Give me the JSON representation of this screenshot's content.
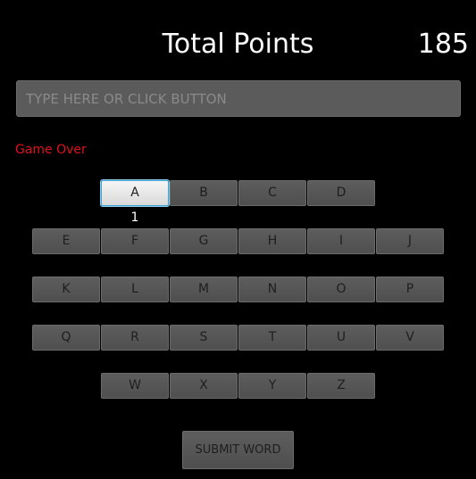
{
  "header": {
    "title": "Total Points",
    "score": "185"
  },
  "word_input": {
    "value": "",
    "placeholder": "TYPE HERE OR CLICK BUTTON"
  },
  "status": {
    "text": "Game Over",
    "color": "#e0101b"
  },
  "keyboard": {
    "rows": [
      [
        "A",
        "B",
        "C",
        "D"
      ],
      [
        "E",
        "F",
        "G",
        "H",
        "I",
        "J"
      ],
      [
        "K",
        "L",
        "M",
        "N",
        "O",
        "P"
      ],
      [
        "Q",
        "R",
        "S",
        "T",
        "U",
        "V"
      ],
      [
        "W",
        "X",
        "Y",
        "Z"
      ]
    ],
    "selected_key": "A",
    "selected_key_count": "1"
  },
  "submit": {
    "label": "SUBMIT WORD"
  },
  "colors": {
    "background": "#000000",
    "button": "#575757",
    "selected_button": "#eeeeee",
    "selected_border": "#3fa3d1"
  }
}
